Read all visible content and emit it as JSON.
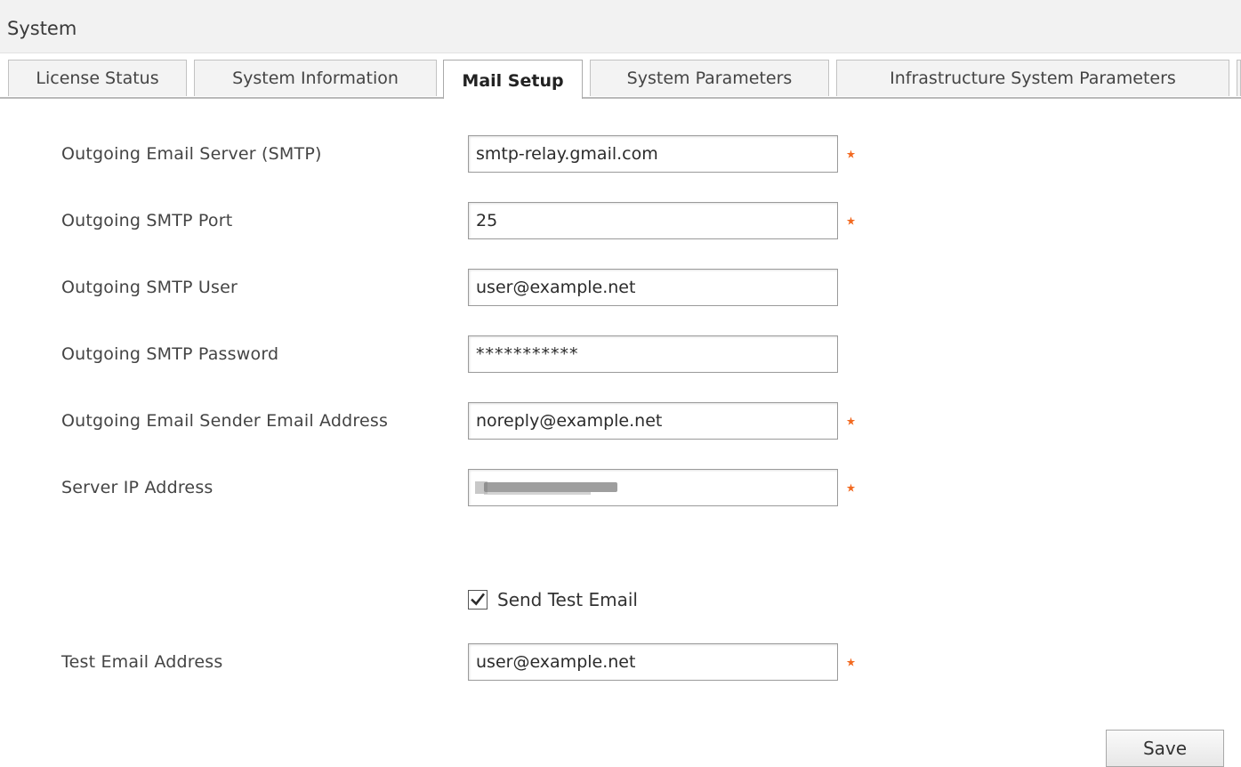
{
  "header": {
    "title": "System"
  },
  "tabs": [
    {
      "label": "License Status",
      "active": false
    },
    {
      "label": "System Information",
      "active": false
    },
    {
      "label": "Mail Setup",
      "active": true
    },
    {
      "label": "System Parameters",
      "active": false
    },
    {
      "label": "Infrastructure System Parameters",
      "active": false
    }
  ],
  "form": {
    "smtp_server": {
      "label": "Outgoing Email Server (SMTP)",
      "value": "smtp-relay.gmail.com",
      "required": true
    },
    "smtp_port": {
      "label": "Outgoing SMTP Port",
      "value": "25",
      "required": true
    },
    "smtp_user": {
      "label": "Outgoing SMTP User",
      "value": "user@example.net",
      "required": false
    },
    "smtp_password": {
      "label": "Outgoing SMTP Password",
      "value": "***********",
      "required": false
    },
    "sender_address": {
      "label": "Outgoing Email Sender Email Address",
      "value": "noreply@example.net",
      "required": true
    },
    "server_ip": {
      "label": "Server IP Address",
      "value": "",
      "required": true
    },
    "send_test_email": {
      "label": "Send Test Email",
      "checked": true
    },
    "test_email_address": {
      "label": "Test Email Address",
      "value": "user@example.net",
      "required": true
    }
  },
  "actions": {
    "save_label": "Save"
  },
  "colors": {
    "required_marker": "#f26a21"
  },
  "icons": {
    "required": "asterisk-icon",
    "checkbox": "checkmark-icon"
  }
}
